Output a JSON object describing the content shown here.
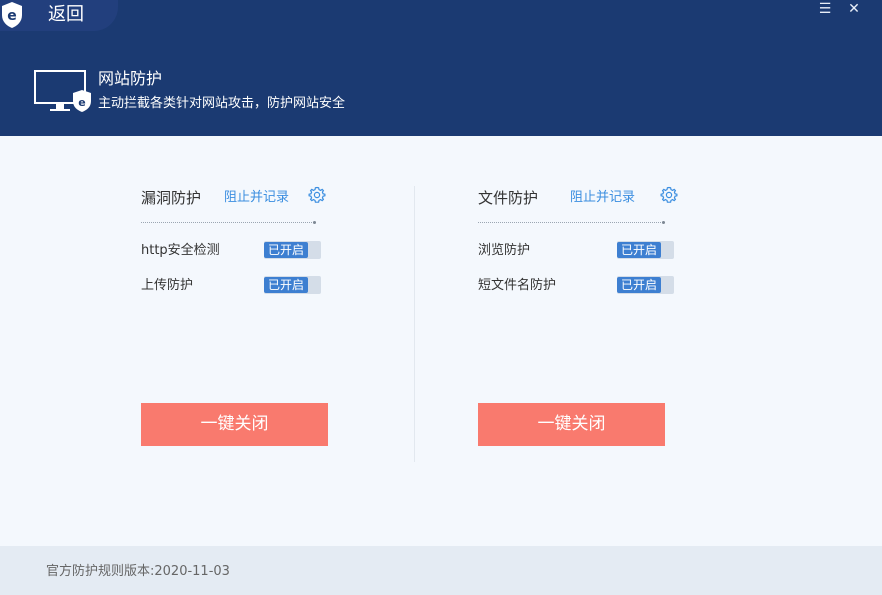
{
  "window": {
    "back_label": "返回",
    "menu_icon": "menu-icon",
    "close_icon": "close-icon"
  },
  "header": {
    "title": "网站防护",
    "subtitle": "主动拦截各类针对网站攻击，防护网站安全",
    "icon": "monitor-shield-icon"
  },
  "panels": [
    {
      "title": "漏洞防护",
      "mode_link": "阻止并记录",
      "rows": [
        {
          "label": "http安全检测",
          "status": "已开启"
        },
        {
          "label": "上传防护",
          "status": "已开启"
        }
      ],
      "button": "一键关闭"
    },
    {
      "title": "文件防护",
      "mode_link": "阻止并记录",
      "rows": [
        {
          "label": "浏览防护",
          "status": "已开启"
        },
        {
          "label": "短文件名防护",
          "status": "已开启"
        }
      ],
      "button": "一键关闭"
    }
  ],
  "footer": {
    "version_text": "官方防护规则版本:2020-11-03"
  },
  "colors": {
    "header_bg": "#1b3a72",
    "accent_link": "#3b8ee0",
    "toggle_on": "#3d7fd1",
    "danger_button": "#f97a6e"
  }
}
